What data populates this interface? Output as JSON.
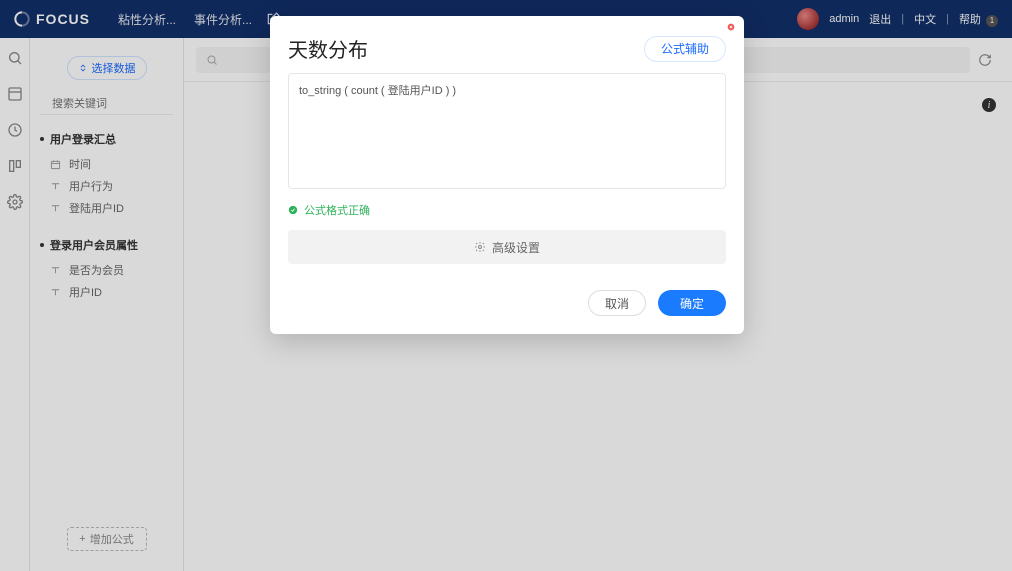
{
  "header": {
    "brand": "FOCUS",
    "tabs": [
      "粘性分析...",
      "事件分析..."
    ],
    "user": "admin",
    "logout": "退出",
    "lang": "中文",
    "help_label": "帮助",
    "help_badge": "1"
  },
  "sidebar": {
    "select_data": "选择数据",
    "search_placeholder": "搜索关键词",
    "groups": [
      {
        "title": "用户登录汇总",
        "fields": [
          {
            "icon": "calendar",
            "label": "时间"
          },
          {
            "icon": "text",
            "label": "用户行为"
          },
          {
            "icon": "text",
            "label": "登陆用户ID"
          }
        ]
      },
      {
        "title": "登录用户会员属性",
        "fields": [
          {
            "icon": "text",
            "label": "是否为会员"
          },
          {
            "icon": "text",
            "label": "用户ID"
          }
        ]
      }
    ],
    "add_formula": "增加公式"
  },
  "modal": {
    "title": "天数分布",
    "assist": "公式辅助",
    "formula": "to_string ( count ( 登陆用户ID ) )",
    "valid_text": "公式格式正确",
    "advanced": "高级设置",
    "cancel": "取消",
    "confirm": "确定"
  }
}
